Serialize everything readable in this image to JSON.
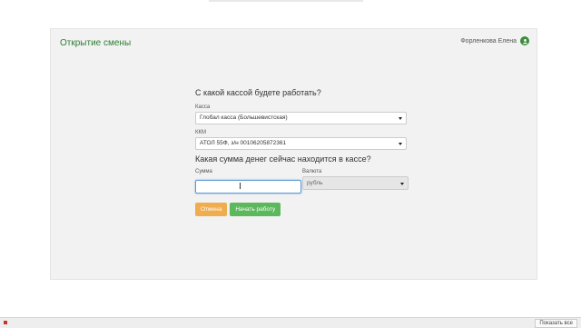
{
  "panel": {
    "title": "Открытие смены",
    "user_name": "Форленкова Елена"
  },
  "form": {
    "question_register": "С какой кассой будете работать?",
    "kassa_label": "Касса",
    "kassa_value": "Глобал касса (Большевистская)",
    "kkm_label": "ККМ",
    "kkm_value": "АТОЛ 55Ф, з/н 00106205872361",
    "question_amount": "Какая сумма денег сейчас находится в кассе?",
    "sum_label": "Сумма",
    "sum_value": "",
    "currency_label": "Валюта",
    "currency_value": "рубль",
    "cancel_label": "Отмена",
    "start_label": "Начать работу"
  },
  "footer": {
    "right_button": "Показать все"
  },
  "colors": {
    "title_green": "#2e7d32",
    "start_button": "#5cb85c",
    "cancel_button": "#f0ad4e"
  },
  "icons": {
    "user": "user-icon",
    "dropdown": "chevron-down-icon"
  }
}
